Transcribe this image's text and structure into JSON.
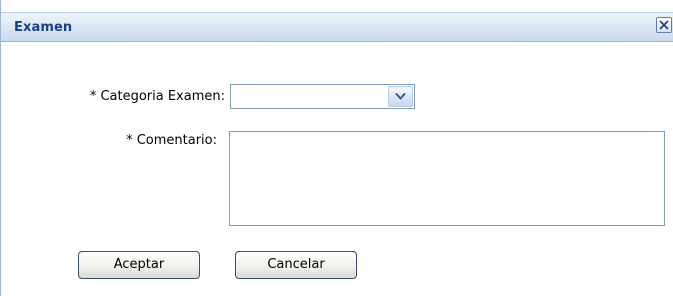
{
  "dialog": {
    "title": "Examen",
    "close_icon": "close-icon"
  },
  "form": {
    "categoria": {
      "label": "* Categoria Examen:",
      "value": "",
      "icon": "chevron-down-icon"
    },
    "comentario": {
      "label": "* Comentario:",
      "value": ""
    }
  },
  "buttons": {
    "accept_label": "Aceptar",
    "cancel_label": "Cancelar"
  },
  "colors": {
    "title_text": "#15428b",
    "titlebar_border": "#9fb5d0",
    "input_border": "#7f9db9",
    "button_border": "#3c4c6a"
  }
}
